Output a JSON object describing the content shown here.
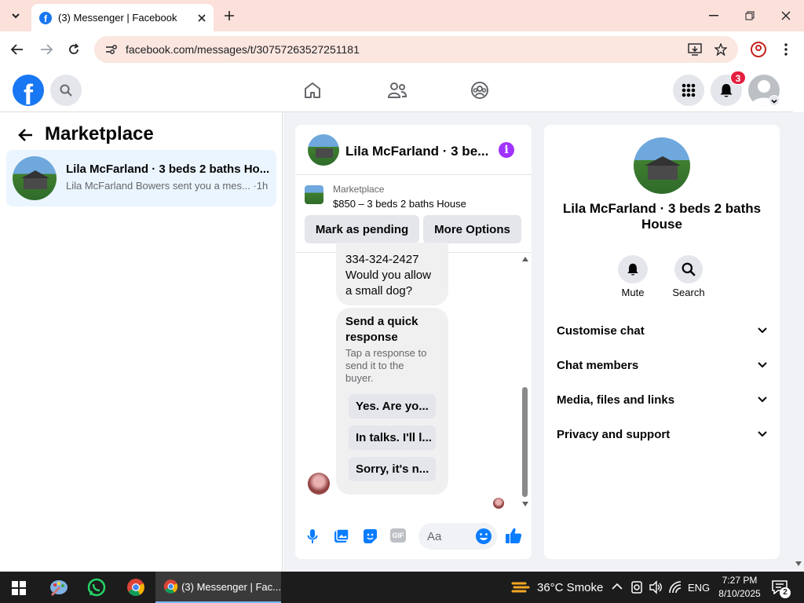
{
  "browser": {
    "tab_title": "(3) Messenger | Facebook",
    "url": "facebook.com/messages/t/30757263527251181"
  },
  "fb_header": {
    "notification_count": "3"
  },
  "left_pane": {
    "title": "Marketplace",
    "chat_item": {
      "name": "Lila McFarland · 3 beds 2 baths Ho...",
      "preview": "Lila McFarland Bowers sent you a mes... ·1h"
    }
  },
  "chat": {
    "header_title": "Lila McFarland · 3 be...",
    "listing_source": "Marketplace",
    "listing_detail": "$850 – 3 beds 2 baths House",
    "mark_pending": "Mark as pending",
    "more_options": "More Options",
    "message_lines": [
      "334-324-2427",
      "Would you allow",
      "a small dog?"
    ],
    "quick_title": "Send a quick response",
    "quick_subtitle": "Tap a response to send it to the buyer.",
    "quick_replies": [
      "Yes. Are yo...",
      "In talks. I'll l...",
      "Sorry, it's n..."
    ],
    "composer_placeholder": "Aa"
  },
  "info_panel": {
    "name": "Lila McFarland · 3 beds 2 baths House",
    "mute_label": "Mute",
    "search_label": "Search",
    "sections": [
      "Customise chat",
      "Chat members",
      "Media, files and links",
      "Privacy and support"
    ]
  },
  "taskbar": {
    "app_label": "(3) Messenger | Fac...",
    "weather": "36°C Smoke",
    "lang": "ENG",
    "time": "7:27 PM",
    "date": "8/10/2025",
    "notif_count": "2"
  },
  "colors": {
    "facebook_blue": "#1877f2",
    "messenger_purple": "#a033ff",
    "badge_red": "#e41e3f"
  }
}
